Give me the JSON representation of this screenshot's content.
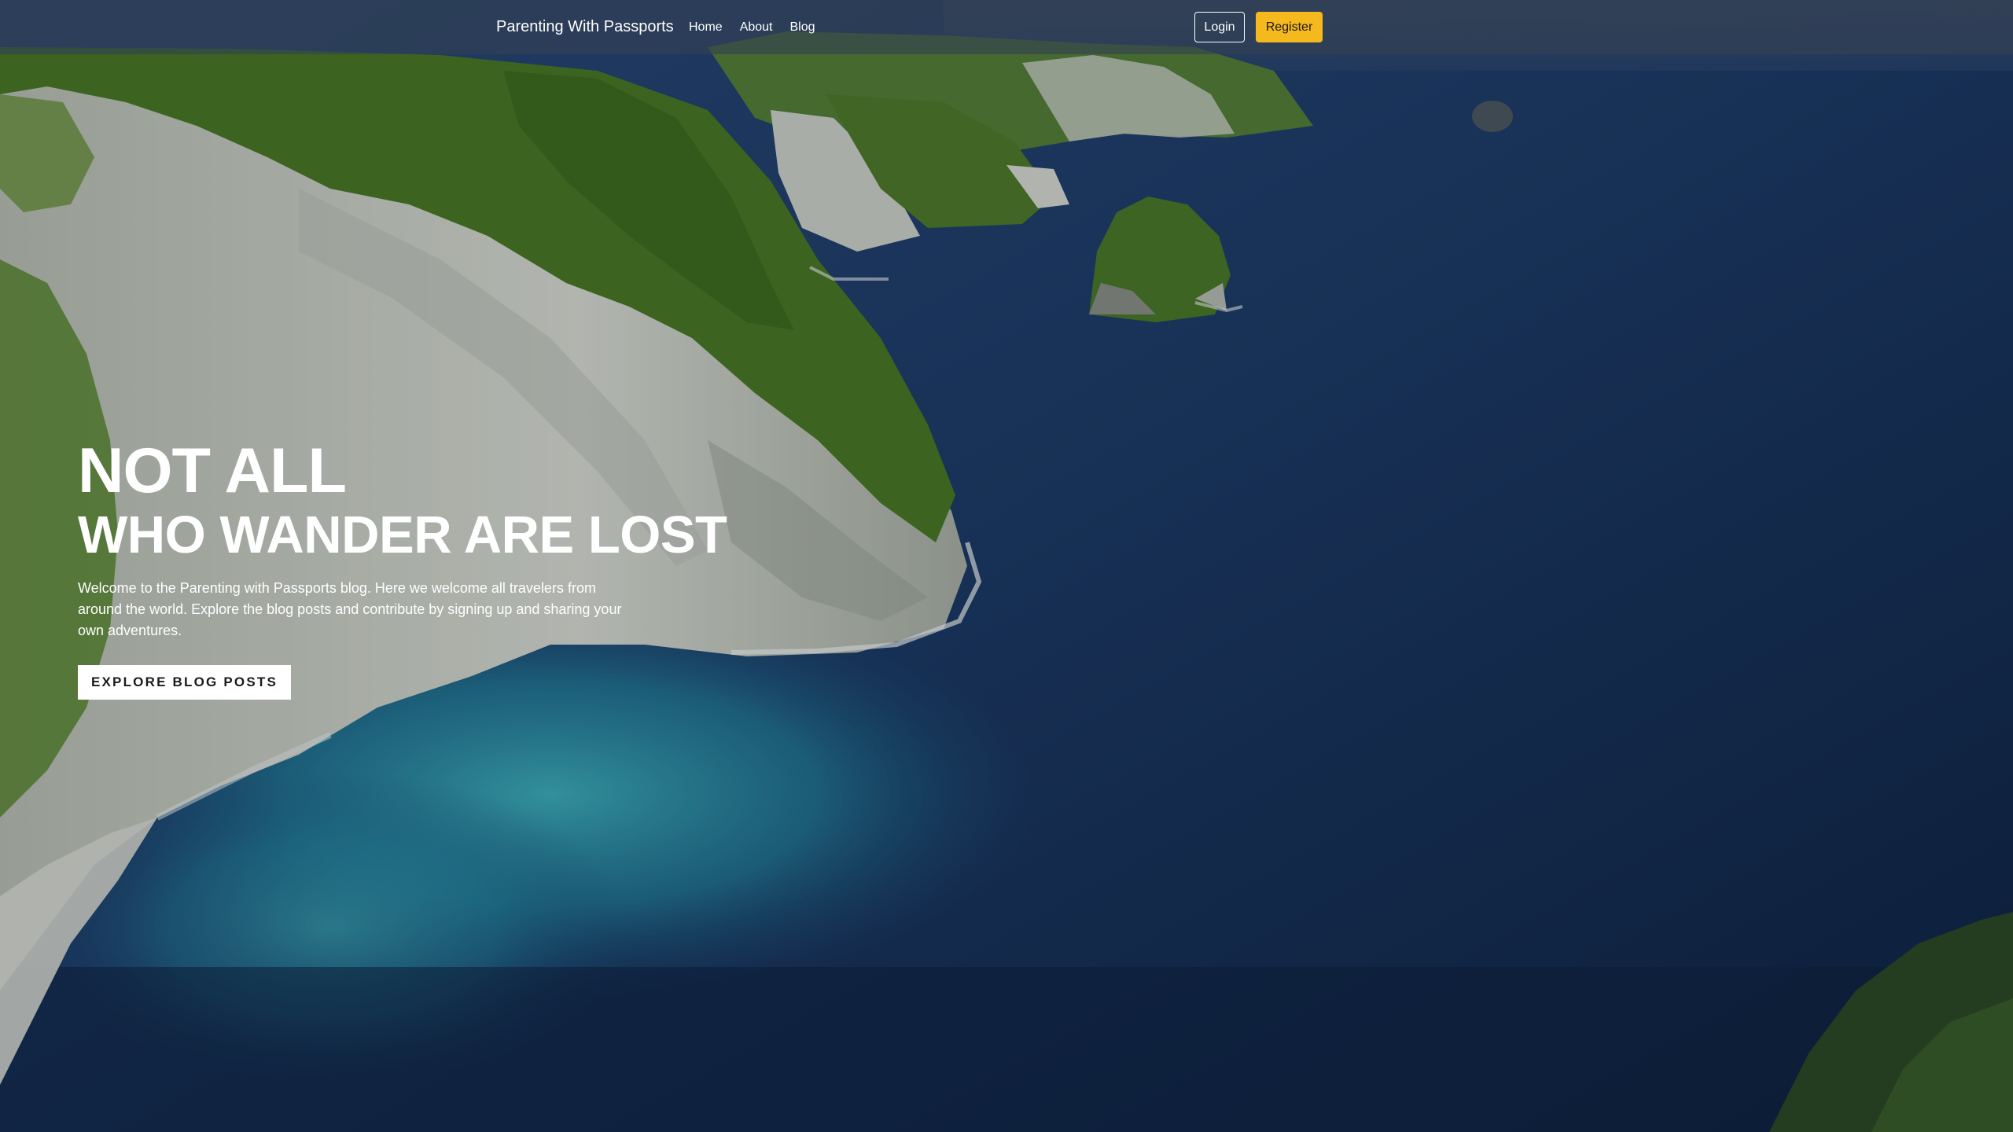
{
  "navbar": {
    "brand": "Parenting With Passports",
    "links": [
      {
        "label": "Home"
      },
      {
        "label": "About"
      },
      {
        "label": "Blog"
      }
    ],
    "login_label": "Login",
    "register_label": "Register"
  },
  "hero": {
    "title_line1": "NOT ALL",
    "title_line2": "WHO WANDER ARE LOST",
    "text": "Welcome to the Parenting with Passports blog. Here we welcome all travelers from around the world. Explore the blog posts and contribute by signing up and sharing your own adventures.",
    "cta_label": "EXPLORE BLOG POSTS"
  },
  "colors": {
    "navbar_bg": "#344054",
    "register_button": "#f5b81d",
    "ocean_deep": "#142d52",
    "lagoon": "#2a9fb0",
    "cliff_green": "#4d7a2a",
    "cliff_rock": "#cfd3cc"
  }
}
